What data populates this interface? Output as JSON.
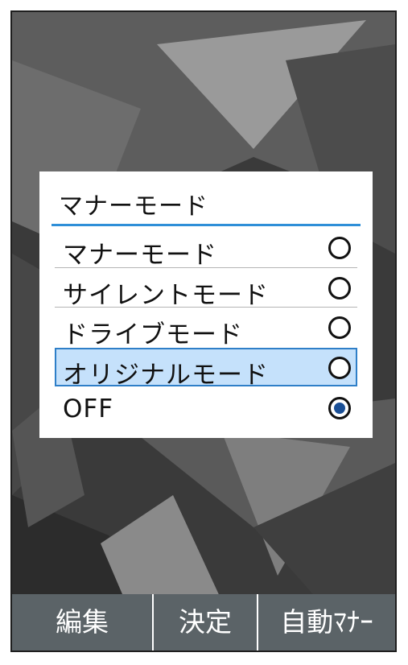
{
  "dialog": {
    "title": "マナーモード",
    "options": [
      {
        "label": "マナーモード",
        "selected": false
      },
      {
        "label": "サイレントモード",
        "selected": false
      },
      {
        "label": "ドライブモード",
        "selected": false
      },
      {
        "label": "オリジナルモード",
        "selected": false,
        "focused": true
      },
      {
        "label": "OFF",
        "selected": true
      }
    ]
  },
  "softkeys": {
    "left": "編集",
    "center": "決定",
    "right": "自動ﾏﾅｰ"
  },
  "colors": {
    "accent": "#2f8fd8",
    "focus_bg": "#c5e1fb",
    "radio_fill": "#1a4f96",
    "softkey_bar": "#5b6367"
  }
}
